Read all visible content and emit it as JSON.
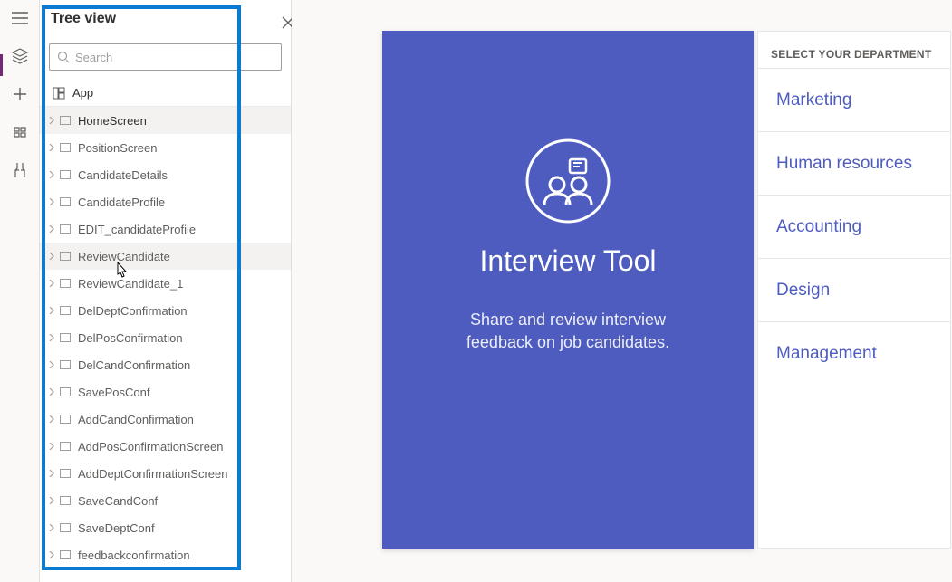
{
  "tree": {
    "title": "Tree view",
    "search_placeholder": "Search",
    "app_label": "App",
    "items": [
      {
        "label": "HomeScreen",
        "selected": true,
        "more": true
      },
      {
        "label": "PositionScreen"
      },
      {
        "label": "CandidateDetails"
      },
      {
        "label": "CandidateProfile"
      },
      {
        "label": "EDIT_candidateProfile"
      },
      {
        "label": "ReviewCandidate",
        "hovered": true,
        "more": true
      },
      {
        "label": "ReviewCandidate_1"
      },
      {
        "label": "DelDeptConfirmation"
      },
      {
        "label": "DelPosConfirmation"
      },
      {
        "label": "DelCandConfirmation"
      },
      {
        "label": "SavePosConf"
      },
      {
        "label": "AddCandConfirmation"
      },
      {
        "label": "AddPosConfirmationScreen"
      },
      {
        "label": "AddDeptConfirmationScreen"
      },
      {
        "label": "SaveCandConf"
      },
      {
        "label": "SaveDeptConf"
      },
      {
        "label": "feedbackconfirmation"
      }
    ]
  },
  "preview": {
    "title": "Interview Tool",
    "subtitle_line1": "Share and review interview",
    "subtitle_line2": "feedback on job candidates."
  },
  "departments": {
    "header": "SELECT YOUR DEPARTMENT",
    "items": [
      {
        "label": "Marketing"
      },
      {
        "label": "Human resources"
      },
      {
        "label": "Accounting"
      },
      {
        "label": "Design"
      },
      {
        "label": "Management"
      }
    ]
  },
  "colors": {
    "brand": "#4e5cbf",
    "highlight": "#0b7ad1"
  }
}
